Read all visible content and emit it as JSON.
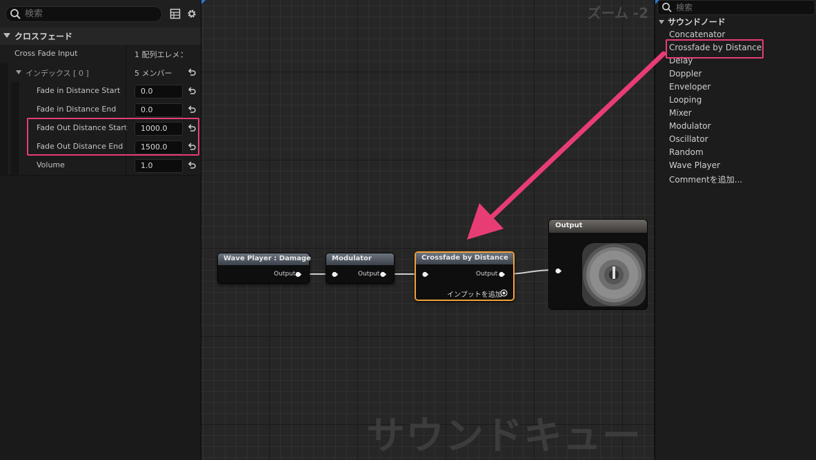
{
  "details": {
    "search_placeholder": "検索",
    "section_title": "クロスフェード",
    "rows": [
      {
        "name": "Cross Fade Input",
        "value": "1 配列エレメン"
      },
      {
        "name": "インデックス [ 0 ]",
        "value": "5 メンバー"
      },
      {
        "name": "Fade in Distance Start",
        "value": "0.0"
      },
      {
        "name": "Fade in Distance End",
        "value": "0.0"
      },
      {
        "name": "Fade Out Distance Start",
        "value": "1000.0"
      },
      {
        "name": "Fade Out Distance End",
        "value": "1500.0"
      },
      {
        "name": "Volume",
        "value": "1.0"
      }
    ]
  },
  "graph": {
    "zoom_label": "ズーム -2",
    "watermark": "サウンドキュー",
    "nodes": {
      "wave_player": {
        "title": "Wave Player : Damage",
        "output": "Output"
      },
      "modulator": {
        "title": "Modulator",
        "output": "Output"
      },
      "crossfade": {
        "title": "Crossfade by Distance",
        "output": "Output",
        "add_input": "インプットを追加"
      },
      "output": {
        "title": "Output"
      }
    }
  },
  "palette": {
    "search_placeholder": "検索",
    "category": "サウンドノード",
    "items": [
      "Concatenator",
      "Crossfade by Distance",
      "Delay",
      "Doppler",
      "Enveloper",
      "Looping",
      "Mixer",
      "Modulator",
      "Oscillator",
      "Random",
      "Wave Player",
      "Commentを追加..."
    ]
  },
  "colors": {
    "highlight": "#e83d74",
    "selected_node": "#f0a23a",
    "arrow": "#e83d74"
  }
}
